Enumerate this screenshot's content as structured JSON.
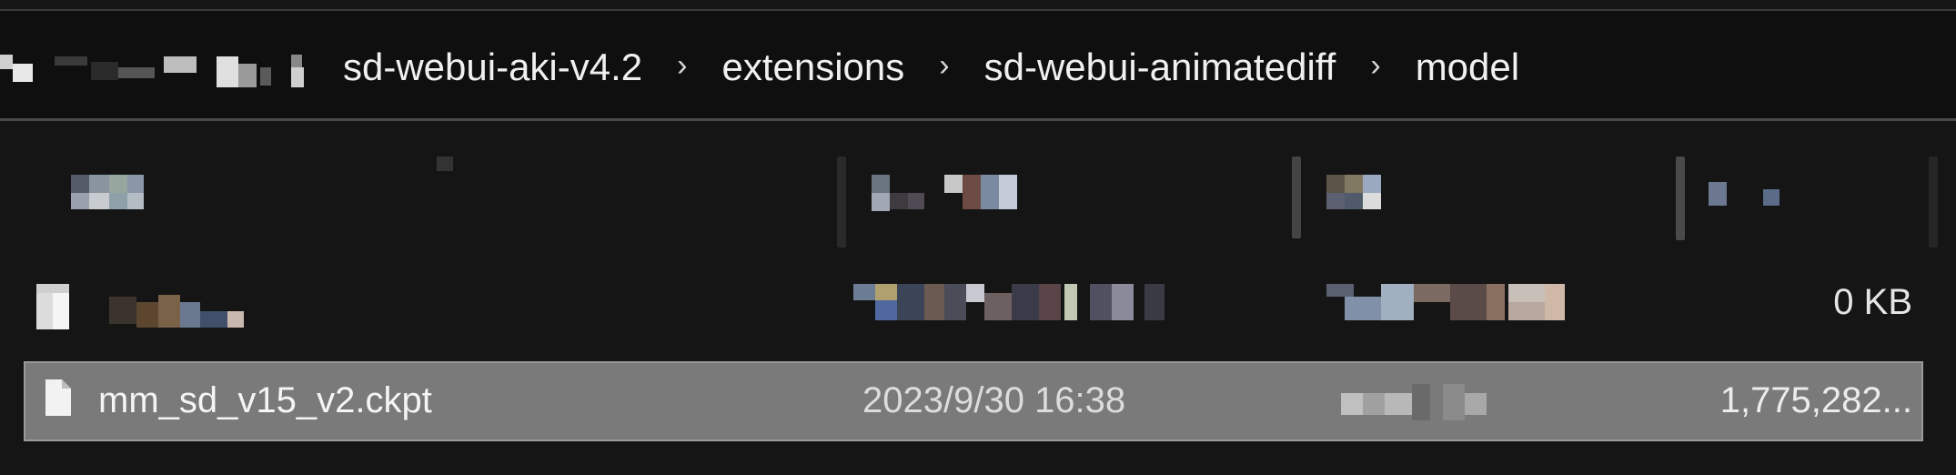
{
  "breadcrumb": {
    "items": [
      "sd-webui-aki-v4.2",
      "extensions",
      "sd-webui-animatediff",
      "model"
    ],
    "separator": "›"
  },
  "rows": [
    {
      "name": "",
      "date": "",
      "type": "",
      "size": "0 KB",
      "blurred": true
    },
    {
      "name": "mm_sd_v15_v2.ckpt",
      "date": "2023/9/30 16:38",
      "type": "",
      "size": "1,775,282...",
      "selected": true
    }
  ],
  "colors": {
    "background": "#151515",
    "selection": "#7a7a7a",
    "address_bar": "#0f0f0f"
  }
}
